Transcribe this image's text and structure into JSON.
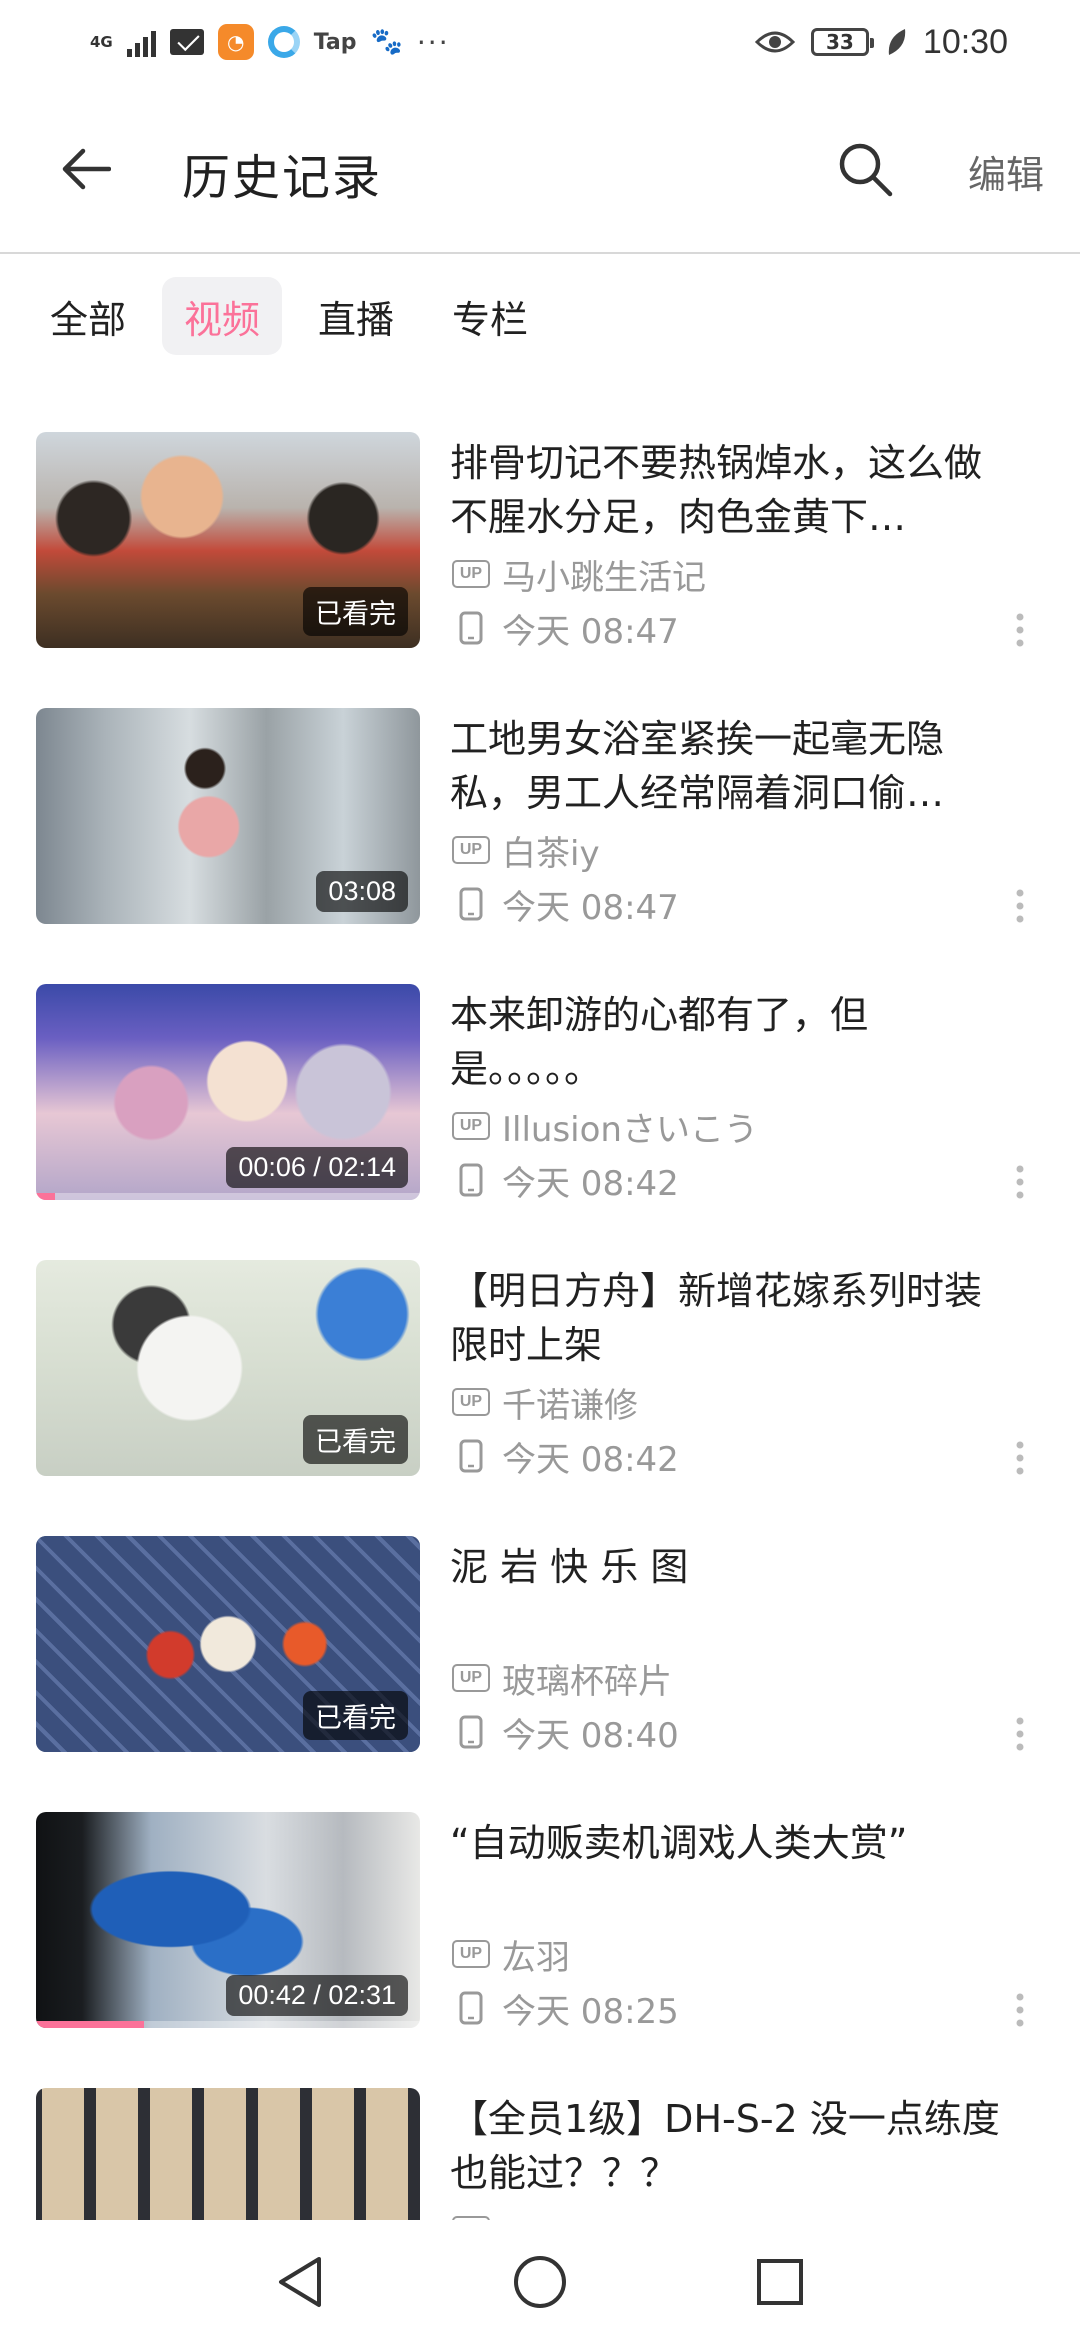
{
  "status_bar": {
    "network": "4G",
    "tap_label": "Tap",
    "more": "···",
    "battery": "33",
    "time": "10:30"
  },
  "header": {
    "title": "历史记录",
    "edit_label": "编辑"
  },
  "tabs": [
    {
      "label": "全部",
      "active": false
    },
    {
      "label": "视频",
      "active": true
    },
    {
      "label": "直播",
      "active": false
    },
    {
      "label": "专栏",
      "active": false
    }
  ],
  "colors": {
    "accent": "#fb7299",
    "text_primary": "#212121",
    "text_secondary": "#999999"
  },
  "up_badge_label": "UP",
  "items": [
    {
      "title": "排骨切记不要热锅焯水，这么做不腥水分足，肉色金黄下…",
      "author": "马小跳生活记",
      "time": "今天 08:47",
      "badge": "已看完",
      "progress": 0,
      "device_icon": "phone-icon"
    },
    {
      "title": "工地男女浴室紧挨一起毫无隐私，男工人经常隔着洞口偷…",
      "author": "白茶iy",
      "time": "今天 08:47",
      "badge": "03:08",
      "progress": 0,
      "device_icon": "phone-icon"
    },
    {
      "title": "本来卸游的心都有了，但是。。。。。",
      "author": "Illusionさいこう",
      "time": "今天 08:42",
      "badge": "00:06 / 02:14",
      "progress": 0.05,
      "device_icon": "phone-icon"
    },
    {
      "title": "【明日方舟】新增花嫁系列时装限时上架",
      "author": "千诺谦修",
      "time": "今天 08:42",
      "badge": "已看完",
      "progress": 0,
      "device_icon": "phone-icon"
    },
    {
      "title": "泥 岩 快 乐 图",
      "author": "玻璃杯碎片",
      "time": "今天 08:40",
      "badge": "已看完",
      "progress": 0,
      "device_icon": "phone-icon"
    },
    {
      "title": "“自动贩卖机调戏人类大赏”",
      "author": "厷羽",
      "time": "今天 08:25",
      "badge": "00:42 / 02:31",
      "progress": 0.28,
      "device_icon": "phone-icon"
    },
    {
      "title": "【全员1级】DH-S-2 没一点练度也能过？？？",
      "author": "",
      "time": "",
      "badge": "",
      "progress": 0,
      "device_icon": "phone-icon"
    }
  ],
  "nav": {
    "back": "triangle-back-icon",
    "home": "circle-home-icon",
    "recents": "square-recents-icon"
  }
}
